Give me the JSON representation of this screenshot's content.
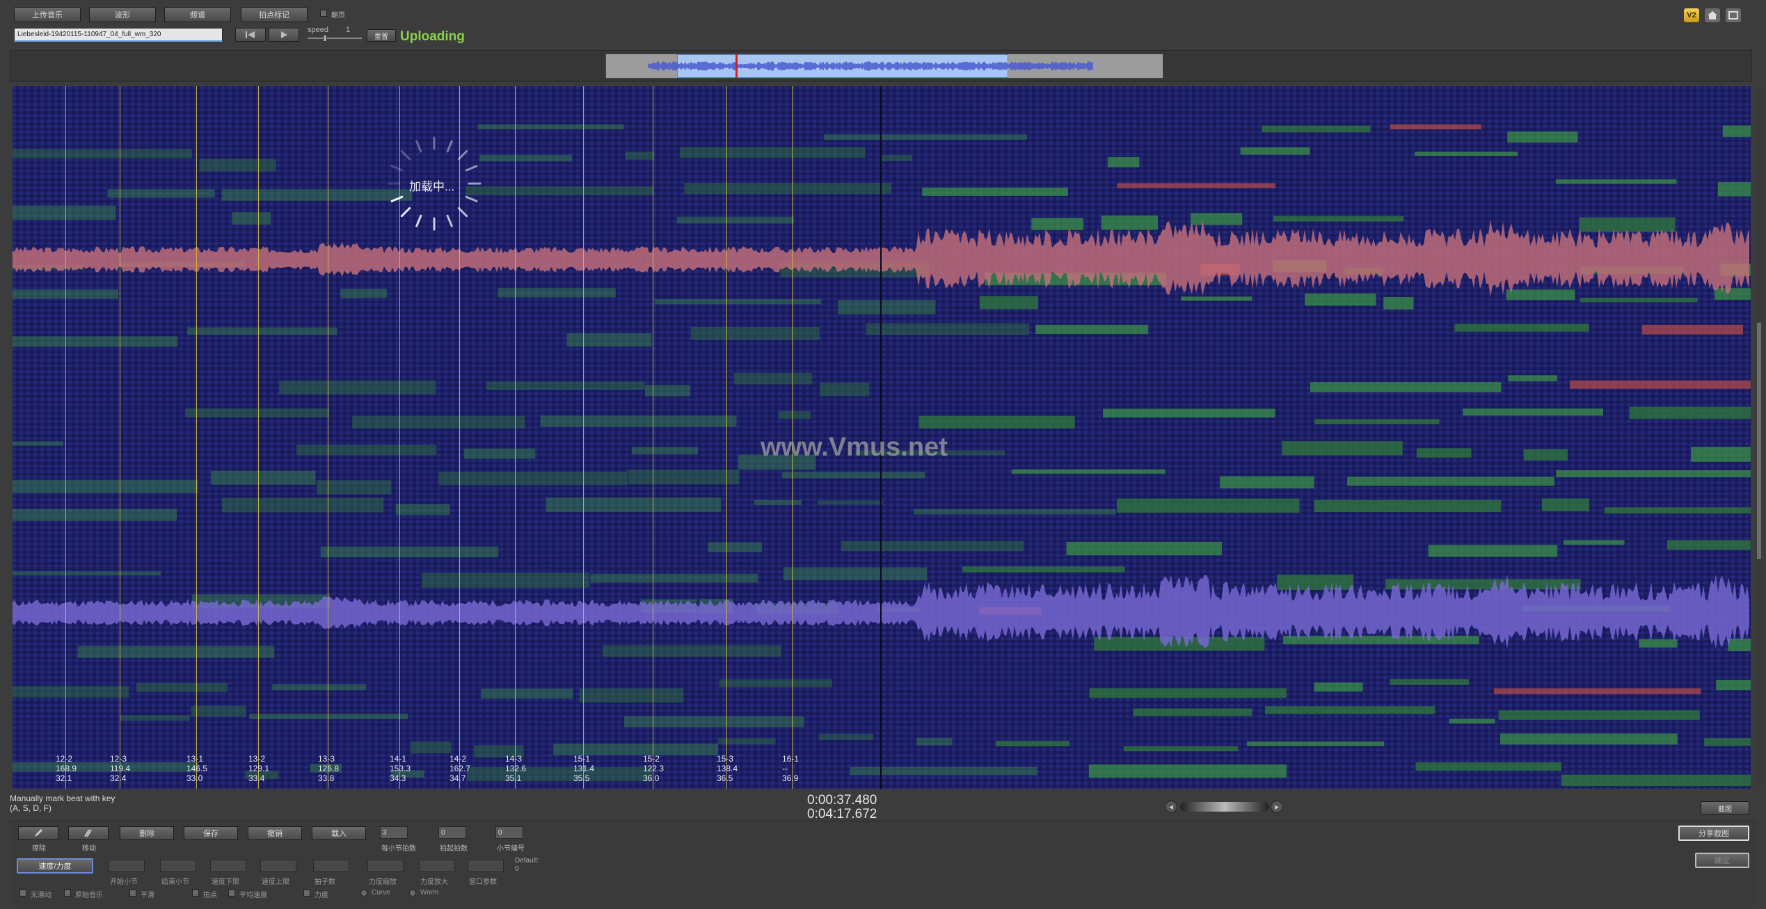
{
  "toolbar": {
    "buttons": [
      "上传音乐",
      "波形",
      "频谱",
      "拍点标记"
    ],
    "checkbox_label": "翻页",
    "filename": "Liebesleid-19420115-110947_04_full_wm_320",
    "speed_label": "speed",
    "speed_value": "1",
    "reset_label": "重置",
    "status": "Uploading"
  },
  "top_right": {
    "badge": "V2"
  },
  "loading": {
    "text": "加载中..."
  },
  "watermark": "www.Vmus.net",
  "beats": [
    {
      "label": "12-2",
      "tempo": "168.9",
      "time": "32.1"
    },
    {
      "label": "12-3",
      "tempo": "119.4",
      "time": "32.4"
    },
    {
      "label": "13-1",
      "tempo": "146.5",
      "time": "33.0"
    },
    {
      "label": "13-2",
      "tempo": "129.1",
      "time": "33.4"
    },
    {
      "label": "13-3",
      "tempo": "126.8",
      "time": "33.8"
    },
    {
      "label": "14-1",
      "tempo": "153.3",
      "time": "34.3"
    },
    {
      "label": "14-2",
      "tempo": "162.7",
      "time": "34.7"
    },
    {
      "label": "14-3",
      "tempo": "132.6",
      "time": "35.1"
    },
    {
      "label": "15-1",
      "tempo": "131.4",
      "time": "35.5"
    },
    {
      "label": "15-2",
      "tempo": "122.3",
      "time": "36.0"
    },
    {
      "label": "15-3",
      "tempo": "138.4",
      "time": "36.5"
    },
    {
      "label": "16-1",
      "tempo": "--",
      "time": "36.9"
    }
  ],
  "hint": {
    "line1": "Manually mark beat with key",
    "line2": "(A, S, D, F)"
  },
  "time": {
    "current": "0:00:37.480",
    "total": "0:04:17.672"
  },
  "screenshot_button": "截图",
  "edit": {
    "tools": [
      {
        "label": "擦除"
      },
      {
        "label": "移动"
      }
    ],
    "actions": [
      "删除",
      "保存",
      "撤销",
      "载入"
    ],
    "beats_per_bar_value": "3",
    "beats_per_bar_label": "每小节拍数",
    "beat_offset_value": "0",
    "beat_offset_label": "拍起拍数",
    "bar_offset_value": "0",
    "bar_offset_label": "小节编号",
    "share_button": "分享截图",
    "confirm_button": "确定",
    "mode_button": "速度/力度",
    "params": [
      "开始小节",
      "结束小节",
      "速度下限",
      "速度上限",
      "拍子数",
      "力度缩放",
      "力度放大",
      "窗口参数"
    ],
    "default_label": "Default:",
    "default_value": "0",
    "options": [
      "无滑动",
      "原始音乐",
      "平滑",
      "拍点",
      "平均速度",
      "力度"
    ],
    "radios": [
      "Curve",
      "Worm"
    ]
  }
}
